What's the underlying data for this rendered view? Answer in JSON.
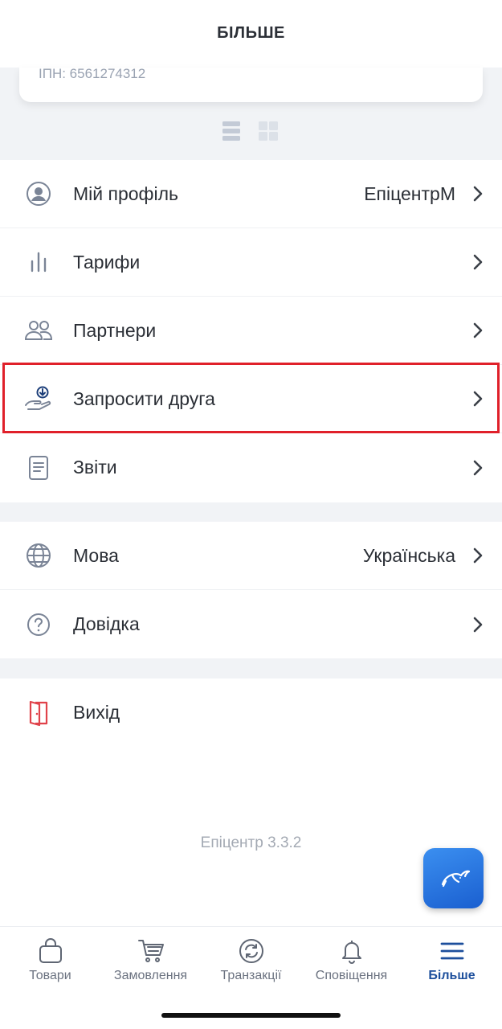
{
  "header": {
    "title": "БІЛЬШЕ"
  },
  "card": {
    "inn": "ІПН: 6561274312"
  },
  "view_toggle": {
    "list_icon": "list-view-icon",
    "grid_icon": "grid-view-icon"
  },
  "menu_group_1": [
    {
      "label": "Мій профіль",
      "value": "ЕпіцентрМ",
      "icon": "profile-icon"
    },
    {
      "label": "Тарифи",
      "value": "",
      "icon": "bar-chart-icon"
    },
    {
      "label": "Партнери",
      "value": "",
      "icon": "partners-icon"
    },
    {
      "label": "Запросити друга",
      "value": "",
      "icon": "invite-friend-icon"
    },
    {
      "label": "Звіти",
      "value": "",
      "icon": "report-icon"
    }
  ],
  "menu_group_2": [
    {
      "label": "Мова",
      "value": "Українська",
      "icon": "globe-icon"
    },
    {
      "label": "Довідка",
      "value": "",
      "icon": "help-icon"
    }
  ],
  "menu_group_3": [
    {
      "label": "Вихід",
      "icon": "logout-door-icon"
    }
  ],
  "version": "Епіцентр 3.3.2",
  "bottom_nav": [
    {
      "label": "Товари",
      "icon": "bag-icon",
      "active": false
    },
    {
      "label": "Замовлення",
      "icon": "cart-icon",
      "active": false
    },
    {
      "label": "Транзакції",
      "icon": "transactions-icon",
      "active": false
    },
    {
      "label": "Сповіщення",
      "icon": "bell-icon",
      "active": false
    },
    {
      "label": "Більше",
      "icon": "menu-icon",
      "active": true
    }
  ],
  "colors": {
    "accent": "#1d4f9c",
    "highlight": "#e0202a",
    "logout": "#e0424a",
    "icon_gray": "#7a8496",
    "background_gray": "#f1f3f6"
  }
}
